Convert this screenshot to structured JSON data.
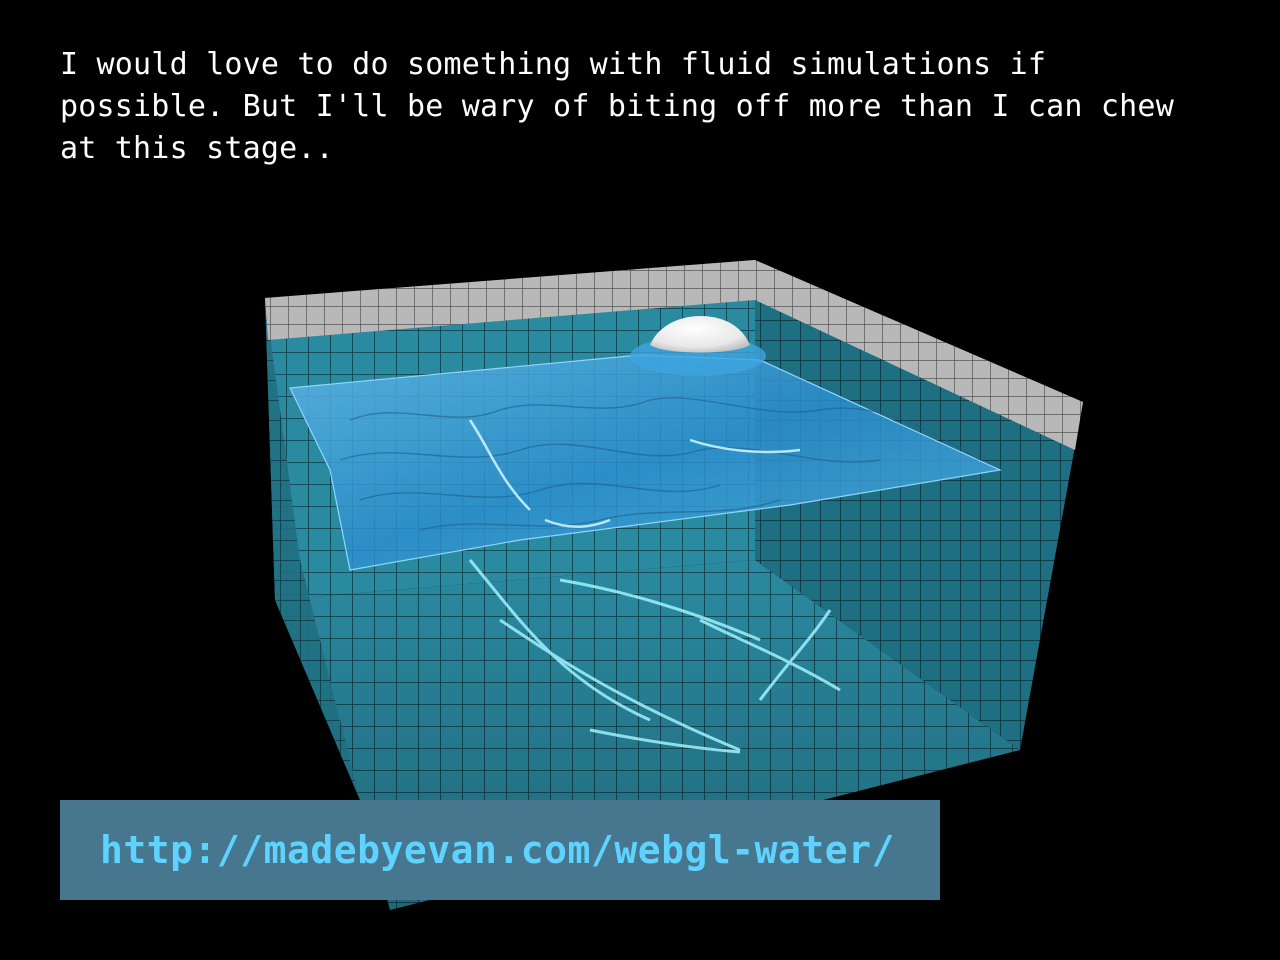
{
  "caption": "I would love to do something with fluid simulations if\npossible. But I'll be wary of biting off more than I can chew\nat this stage..",
  "url": "http://madebyevan.com/webgl-water/",
  "colors": {
    "background": "#000000",
    "caption_text": "#ffffff",
    "url_box": "#46778f",
    "url_text": "#5fd3ff"
  },
  "scene": {
    "subject": "tiled pool with rippling water surface and floating white sphere"
  }
}
